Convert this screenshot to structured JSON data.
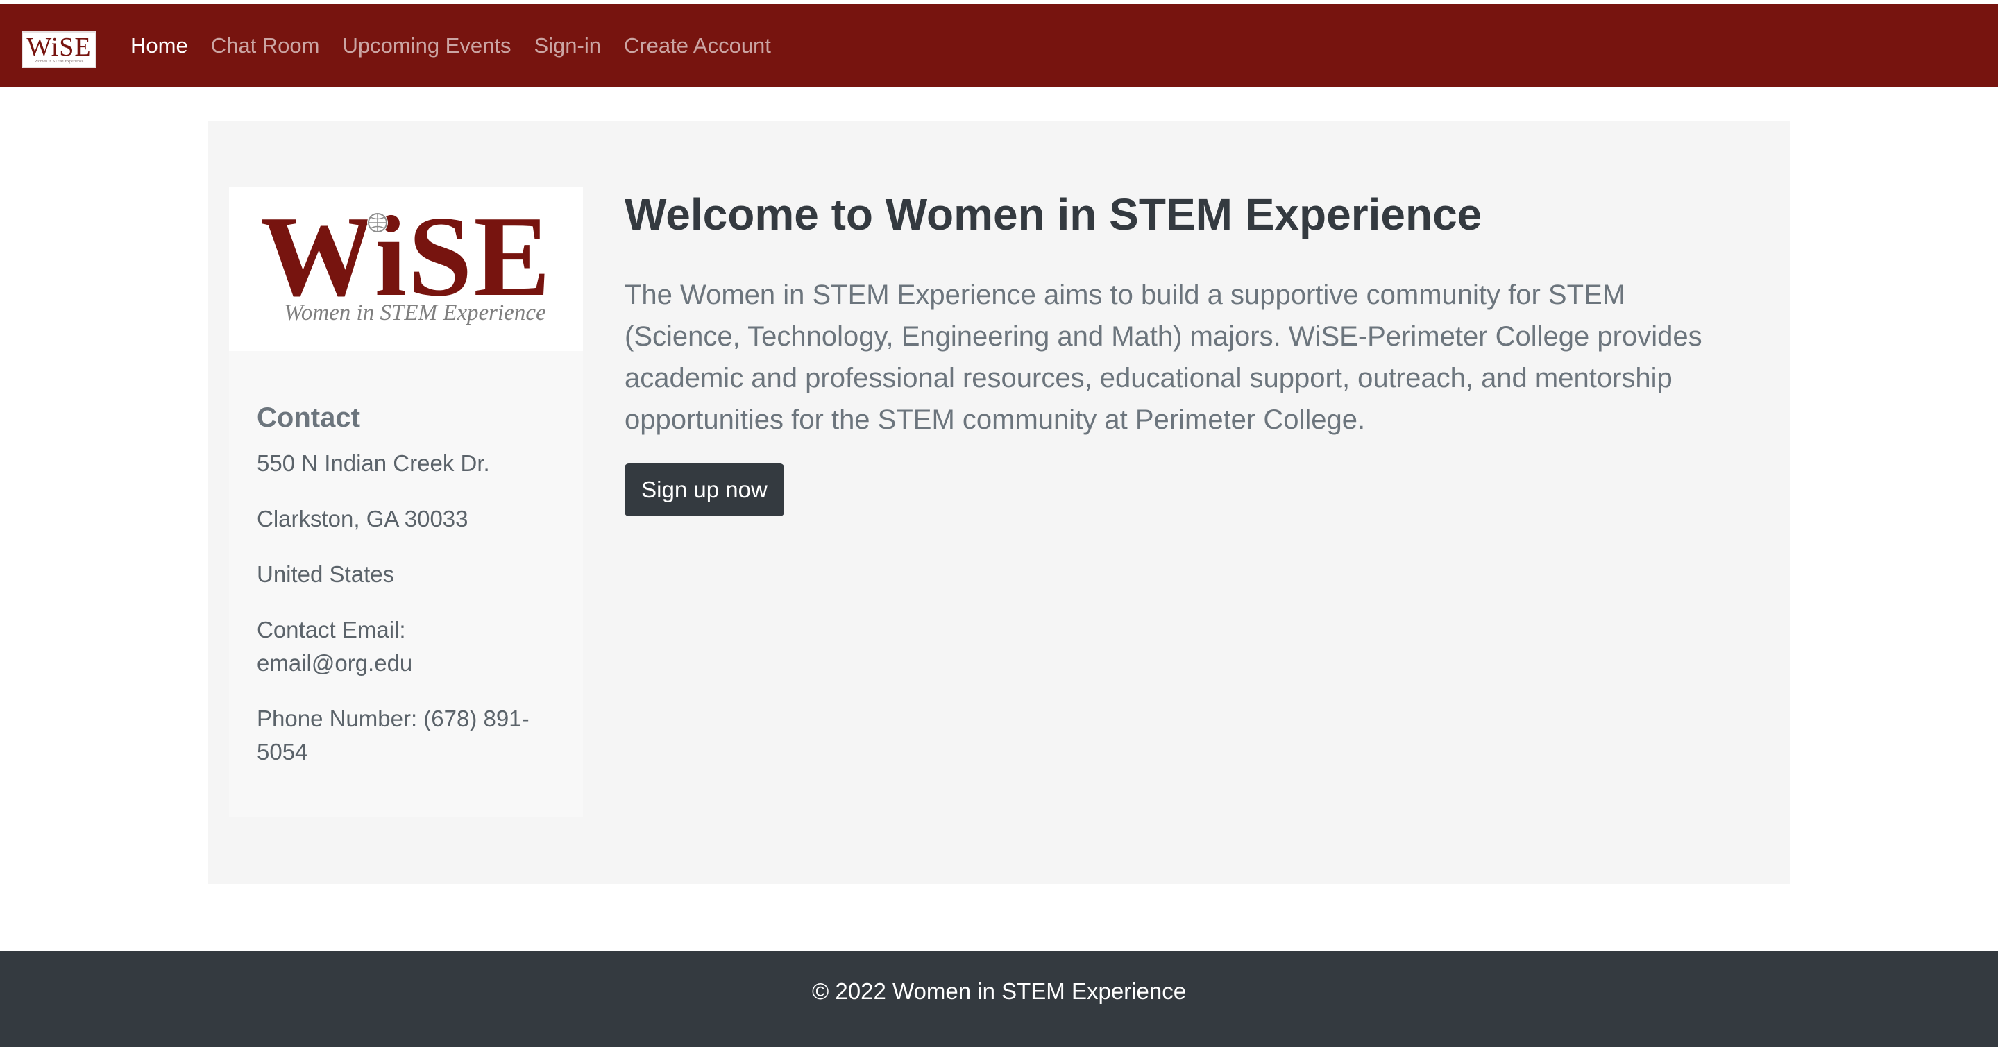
{
  "navbar": {
    "brand_mark": "WiSE",
    "brand_tag": "Women in STEM Experience",
    "links": [
      {
        "label": "Home",
        "active": true
      },
      {
        "label": "Chat Room",
        "active": false
      },
      {
        "label": "Upcoming Events",
        "active": false
      },
      {
        "label": "Sign-in",
        "active": false
      },
      {
        "label": "Create Account",
        "active": false
      }
    ]
  },
  "logo": {
    "mark": "WiSE",
    "tagline": "Women in STEM Experience"
  },
  "contact": {
    "title": "Contact",
    "address_line1": "550 N Indian Creek Dr.",
    "address_line2": "Clarkston, GA 30033",
    "country": "United States",
    "email_label": "Contact Email:",
    "email": "email@org.edu",
    "phone": "Phone Number: (678) 891-5054"
  },
  "main": {
    "title": "Welcome to Women in STEM Experience",
    "description": "The Women in STEM Experience aims to build a supportive community for STEM (Science, Technology, Engineering and Math) majors. WiSE-Perimeter College provides academic and professional resources, educational support, outreach, and mentorship opportunities for the STEM community at Perimeter College.",
    "cta_label": "Sign up now"
  },
  "footer": {
    "text": "© 2022 Women in STEM Experience"
  },
  "colors": {
    "brand": "#77140f",
    "dark": "#343a40",
    "muted": "#6c757d",
    "jumbotron_bg": "#f5f5f5"
  }
}
